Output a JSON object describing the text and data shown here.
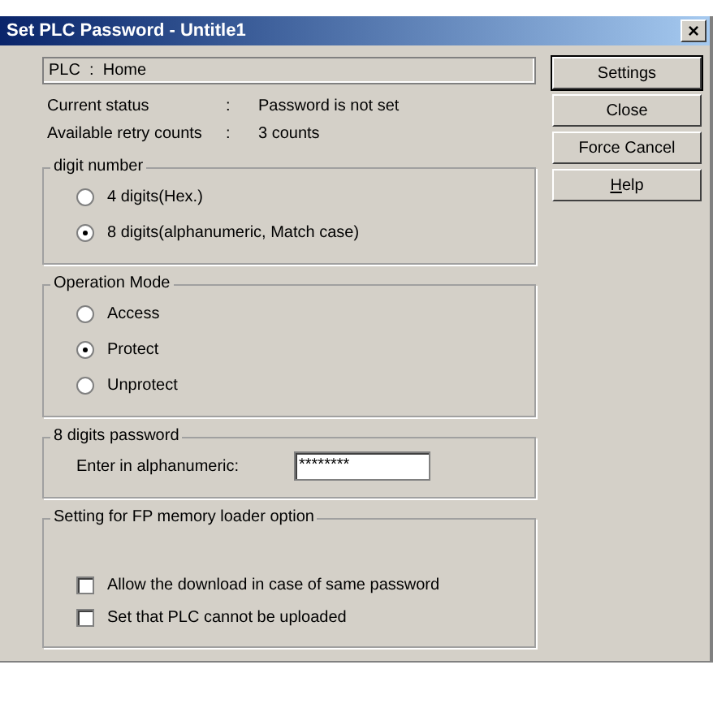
{
  "window": {
    "title": "Set PLC Password - Untitle1",
    "close": "×"
  },
  "plc_field": {
    "value": "PLC  :  Home"
  },
  "status": [
    {
      "label": "Current status",
      "sep": ":",
      "value": "Password is not set"
    },
    {
      "label": "Available retry counts",
      "sep": ":",
      "value": "3 counts"
    }
  ],
  "groups": [
    {
      "kind": "radio",
      "title": "digit number",
      "items": [
        {
          "label": "4 digits(Hex.)",
          "selected": false
        },
        {
          "label": "8 digits(alphanumeric, Match case)",
          "selected": true
        }
      ]
    },
    {
      "kind": "radio",
      "title": "Operation Mode",
      "items": [
        {
          "label": "Access",
          "selected": false
        },
        {
          "label": "Protect",
          "selected": true
        },
        {
          "label": "Unprotect",
          "selected": false
        }
      ]
    },
    {
      "kind": "input",
      "title": "8 digits password",
      "label": "Enter in alphanumeric:",
      "value": "********"
    },
    {
      "kind": "checkbox",
      "title": "Setting for FP memory loader option",
      "items": [
        {
          "label": "Allow the download in case of same password",
          "checked": false
        },
        {
          "label": "Set that PLC cannot be uploaded",
          "checked": false
        }
      ]
    }
  ],
  "buttons": [
    {
      "label": "Settings",
      "default": true
    },
    {
      "label": "Close",
      "default": false
    },
    {
      "label": "Force Cancel",
      "default": false
    },
    {
      "label": "Help",
      "default": false,
      "mnemonic": true
    }
  ]
}
